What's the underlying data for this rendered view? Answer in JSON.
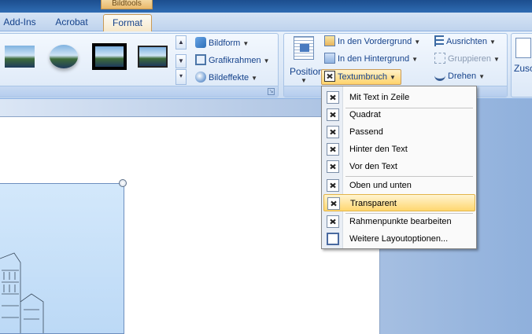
{
  "context_tab_header": "Bildtools",
  "tabs": [
    {
      "label": "Add-Ins"
    },
    {
      "label": "Acrobat"
    },
    {
      "label": "Format"
    }
  ],
  "ribbon": {
    "picture_styles": {
      "thumbnails": [
        "style-1",
        "style-oval",
        "style-black-frame",
        "style-thin-frame"
      ],
      "commands": {
        "bildform": "Bildform",
        "grafikrahmen": "Grafikrahmen",
        "bildeffekte": "Bildeffekte"
      }
    },
    "arrange": {
      "position": "Position",
      "in_den_vordergrund": "In den Vordergrund",
      "in_den_hintergrund": "In den Hintergrund",
      "textumbruch": "Textumbruch",
      "ausrichten": "Ausrichten",
      "gruppieren": "Gruppieren",
      "drehen": "Drehen"
    },
    "size": {
      "zusc": "Zusc"
    }
  },
  "wrap_menu": {
    "items": [
      {
        "label": "Mit Text in Zeile"
      },
      {
        "label": "Quadrat"
      },
      {
        "label": "Passend"
      },
      {
        "label": "Hinter den Text"
      },
      {
        "label": "Vor den Text"
      },
      {
        "label": "Oben und unten"
      },
      {
        "label": "Transparent"
      },
      {
        "label": "Rahmenpunkte bearbeiten"
      },
      {
        "label": "Weitere Layoutoptionen..."
      }
    ]
  },
  "colors": {
    "accent_highlight": "#ffd770",
    "ribbon_blue": "#dbe7f6",
    "text_blue": "#15428b"
  }
}
